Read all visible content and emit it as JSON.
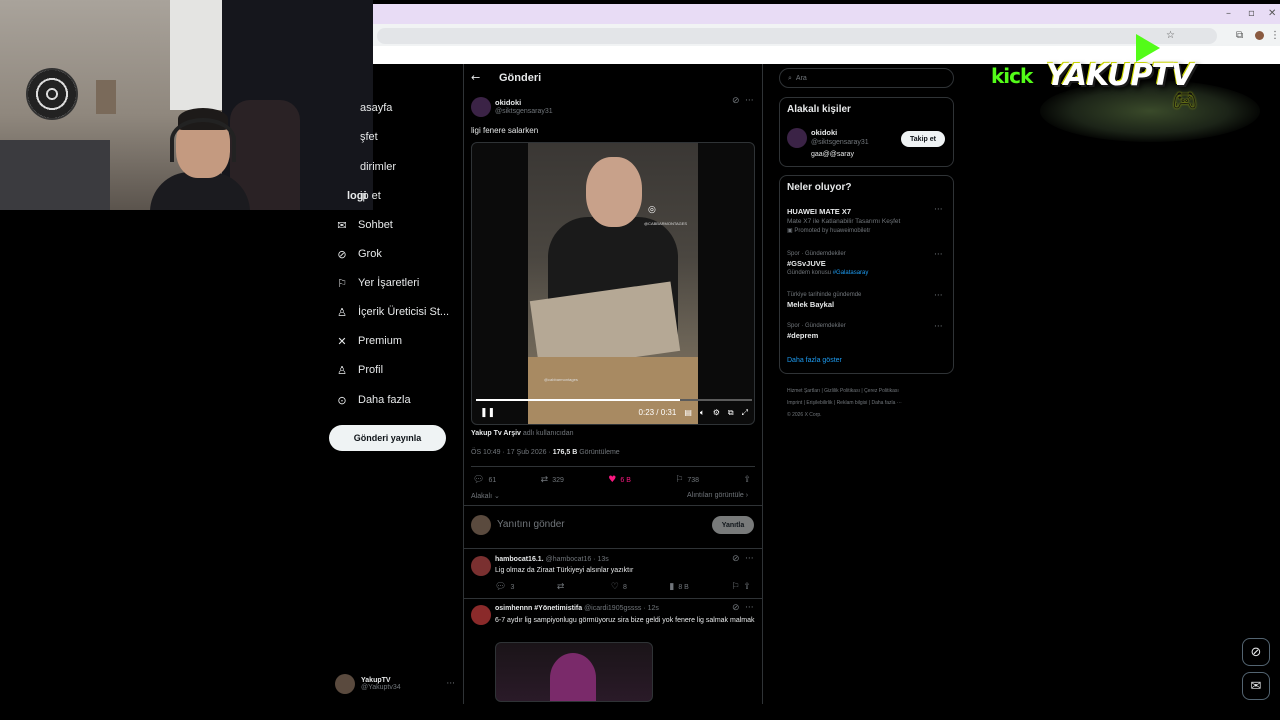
{
  "nav": {
    "items": [
      {
        "label": "asayfa",
        "icon": "home-icon"
      },
      {
        "label": "şfet",
        "icon": "search-icon"
      },
      {
        "label": "dirimler",
        "icon": "bell-icon"
      },
      {
        "label": "ip et",
        "icon": "follow-icon"
      },
      {
        "label": "Sohbet",
        "icon": "mail-icon"
      },
      {
        "label": "Grok",
        "icon": "grok-icon"
      },
      {
        "label": "Yer İşaretleri",
        "icon": "bookmark-icon"
      },
      {
        "label": "İçerik Üreticisi St...",
        "icon": "creator-icon"
      },
      {
        "label": "Premium",
        "icon": "x-icon"
      },
      {
        "label": "Profil",
        "icon": "person-icon"
      },
      {
        "label": "Daha fazla",
        "icon": "more-circle-icon"
      }
    ],
    "logo_fragment": "logi",
    "post_button": "Gönderi yayınla",
    "account": {
      "name": "YakupTV",
      "handle": "@Yakuptv34"
    }
  },
  "main": {
    "title": "Gönderi",
    "post": {
      "author_name": "okidoki",
      "author_handle": "@siktsgensaray31",
      "text": "ligi fenere salarken",
      "video": {
        "time": "0:23 / 0:31",
        "progress": 0.74,
        "watermark": "@CABBARMONTAGES",
        "caption_overlay": "@cabbarmontages"
      },
      "source": {
        "name": "Yakup Tv Arşiv",
        "suffix": "adlı kullanıcıdan"
      },
      "meta": {
        "time": "ÖS 10:49 · 17 Şub 2026 ·",
        "views": "176,5 B",
        "views_label": "Görüntüleme"
      },
      "actions": {
        "replies": "61",
        "reposts": "329",
        "likes": "6 B",
        "bookmarks": "738"
      },
      "relevant_label": "Alakalı",
      "quotes_label": "Alıntıları görüntüle"
    },
    "reply_box": {
      "placeholder": "Yanıtını gönder",
      "button": "Yanıtla"
    },
    "replies": [
      {
        "name": "hambocat16.1.",
        "handle": "@hambocat16 · 13s",
        "text": "Lig olmaz da Ziraat Türkiyeyi alsınlar yazıktır",
        "replies": "3",
        "likes": "8",
        "views": "8 B"
      },
      {
        "name": "osimhennn #Yönetimistifa",
        "handle": "@icardi1905gssss · 12s",
        "text": "6-7 aydır lig sampiyonlugu görmüyoruz sira bize geldi yok fenere lig salmak malmak"
      }
    ]
  },
  "right": {
    "search_placeholder": "Ara",
    "relevant": {
      "title": "Alakalı kişiler",
      "person": {
        "name": "okidoki",
        "handle": "@siktsgensaray31",
        "bio": "gaa@@saray",
        "follow": "Takip et"
      }
    },
    "trends": {
      "title": "Neler oluyor?",
      "items": [
        {
          "category": "",
          "name": "HUAWEI MATE X7",
          "sub": "Mate X7 ile Katlanabilir Tasarımı Keşfet",
          "extra": "Promoted by huaweimobiletr"
        },
        {
          "category": "Spor · Gündemdekiler",
          "name": "#GSvJUVE",
          "sub": "Gündem konusu",
          "link": "#Galatasaray"
        },
        {
          "category": "Türkiye tarihinde gündemde",
          "name": "Melek Baykal"
        },
        {
          "category": "Spor · Gündemdekiler",
          "name": "#deprem"
        }
      ],
      "show_more": "Daha fazla göster"
    },
    "footer": {
      "line1": [
        "Hizmet Şartları",
        "Gizlilik Politikası",
        "Çerez Politikası"
      ],
      "line2": [
        "Imprint",
        "Erişilebilirlik",
        "Reklam bilgisi",
        "Daha fazla ···"
      ],
      "line3": "© 2026 X Corp."
    }
  },
  "overlay": {
    "kick": "kick",
    "brand": "YAKUPTV"
  },
  "colors": {
    "like": "#f91880",
    "link": "#1d9bf0",
    "kick_green": "#53fc18"
  }
}
